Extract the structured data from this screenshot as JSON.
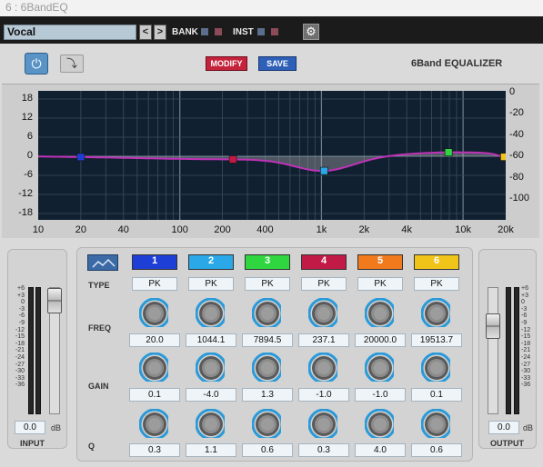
{
  "window": {
    "title": "6 : 6BandEQ"
  },
  "toolbar": {
    "preset": "Vocal",
    "prev": "<",
    "next": ">",
    "bank_label": "BANK",
    "inst_label": "INST",
    "bank_colors": [
      "#5b6f8c",
      "#8c4a5b"
    ],
    "inst_colors": [
      "#5b6f8c",
      "#8c4a5b"
    ],
    "settings_icon": "gear-icon"
  },
  "header": {
    "power_icon": "power-icon",
    "link_icon": "link-icon",
    "modify_label": "MODIFY",
    "save_label": "SAVE",
    "title": "6Band EQUALIZER"
  },
  "graph": {
    "y_left_ticks": [
      "18",
      "12",
      "6",
      "0",
      "-6",
      "-12",
      "-18"
    ],
    "y_right_ticks": [
      "0",
      "-20",
      "-40",
      "-60",
      "-80",
      "-100"
    ],
    "x_ticks": [
      "10",
      "20",
      "40",
      "100",
      "200",
      "400",
      "1k",
      "2k",
      "4k",
      "10k",
      "20k"
    ],
    "curve_color": "#c032b8"
  },
  "input": {
    "label": "INPUT",
    "value": "0.0",
    "unit": "dB",
    "scale": [
      "+6",
      "+3",
      "0",
      "-3",
      "-6",
      "-9",
      "-12",
      "-15",
      "-18",
      "-21",
      "-24",
      "-27",
      "-30",
      "-33",
      "-36"
    ]
  },
  "output": {
    "label": "OUTPUT",
    "value": "0.0",
    "unit": "dB",
    "scale": [
      "+6",
      "+3",
      "0",
      "-3",
      "-6",
      "-9",
      "-12",
      "-15",
      "-18",
      "-21",
      "-24",
      "-27",
      "-30",
      "-33",
      "-36"
    ]
  },
  "bands_panel": {
    "curve_icon": "curve-icon",
    "type_label": "TYPE",
    "freq_label": "FREQ",
    "gain_label": "GAIN",
    "q_label": "Q"
  },
  "bands": [
    {
      "number": "1",
      "color": "#1e3fd6",
      "type": "PK",
      "freq": "20.0",
      "gain": "0.1",
      "q": "0.3"
    },
    {
      "number": "2",
      "color": "#2aa8e8",
      "type": "PK",
      "freq": "1044.1",
      "gain": "-4.0",
      "q": "1.1"
    },
    {
      "number": "3",
      "color": "#2fd63f",
      "type": "PK",
      "freq": "7894.5",
      "gain": "1.3",
      "q": "0.6"
    },
    {
      "number": "4",
      "color": "#c21a46",
      "type": "PK",
      "freq": "237.1",
      "gain": "-1.0",
      "q": "0.3"
    },
    {
      "number": "5",
      "color": "#f07a1c",
      "type": "PK",
      "freq": "20000.0",
      "gain": "-1.0",
      "q": "4.0"
    },
    {
      "number": "6",
      "color": "#f0c419",
      "type": "PK",
      "freq": "19513.7",
      "gain": "0.1",
      "q": "0.6"
    }
  ]
}
